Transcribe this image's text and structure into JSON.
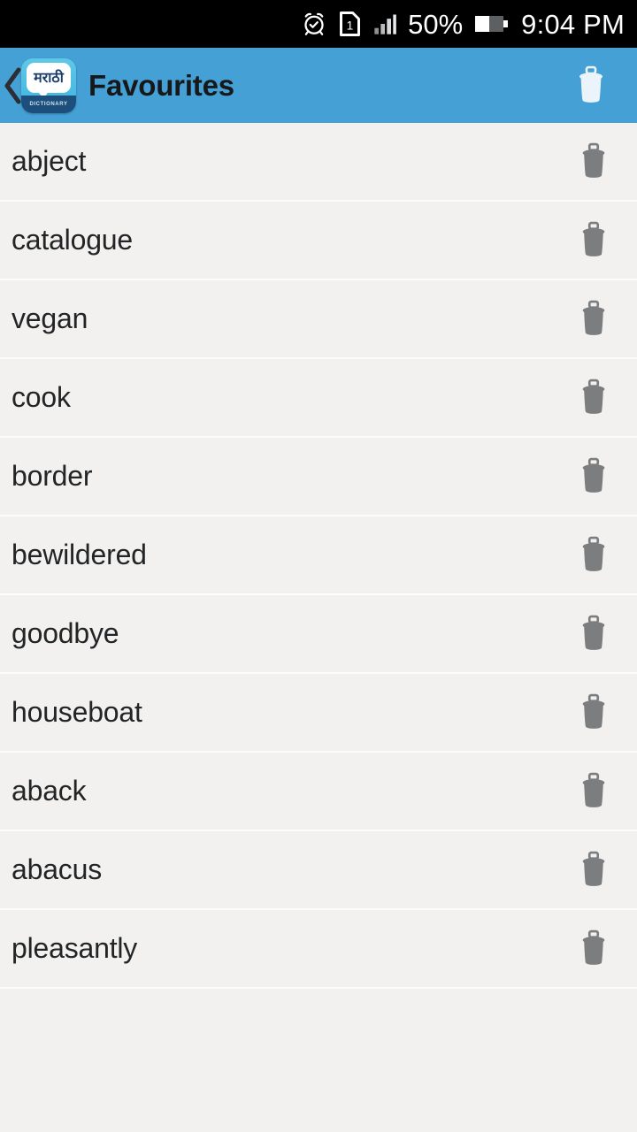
{
  "status_bar": {
    "alarm_icon": "alarm-clock-icon",
    "sim_icon": "sim-card-icon",
    "sim_label": "1",
    "signal_icon": "signal-bars-icon",
    "battery_percent": "50%",
    "battery_icon": "battery-half-icon",
    "time": "9:04 PM",
    "background": "#000000",
    "foreground": "#ffffff"
  },
  "app_bar": {
    "back_icon": "chevron-left-icon",
    "logo": {
      "icon_name": "marathi-dictionary-logo",
      "bubble_text": "मराठी",
      "caption": "DICTIONARY"
    },
    "title": "Favourites",
    "delete_all_icon": "trash-icon",
    "background": "#44a0d5",
    "title_color": "#16181a"
  },
  "list": {
    "row_delete_icon": "trash-icon",
    "row_background": "#f2f1f0",
    "divider_color": "#fcfcfc",
    "text_color": "#222426",
    "items": [
      {
        "word": "abject"
      },
      {
        "word": "catalogue"
      },
      {
        "word": "vegan"
      },
      {
        "word": "cook"
      },
      {
        "word": "border"
      },
      {
        "word": "bewildered"
      },
      {
        "word": "goodbye"
      },
      {
        "word": "houseboat"
      },
      {
        "word": "aback"
      },
      {
        "word": "abacus"
      },
      {
        "word": "pleasantly"
      }
    ]
  }
}
